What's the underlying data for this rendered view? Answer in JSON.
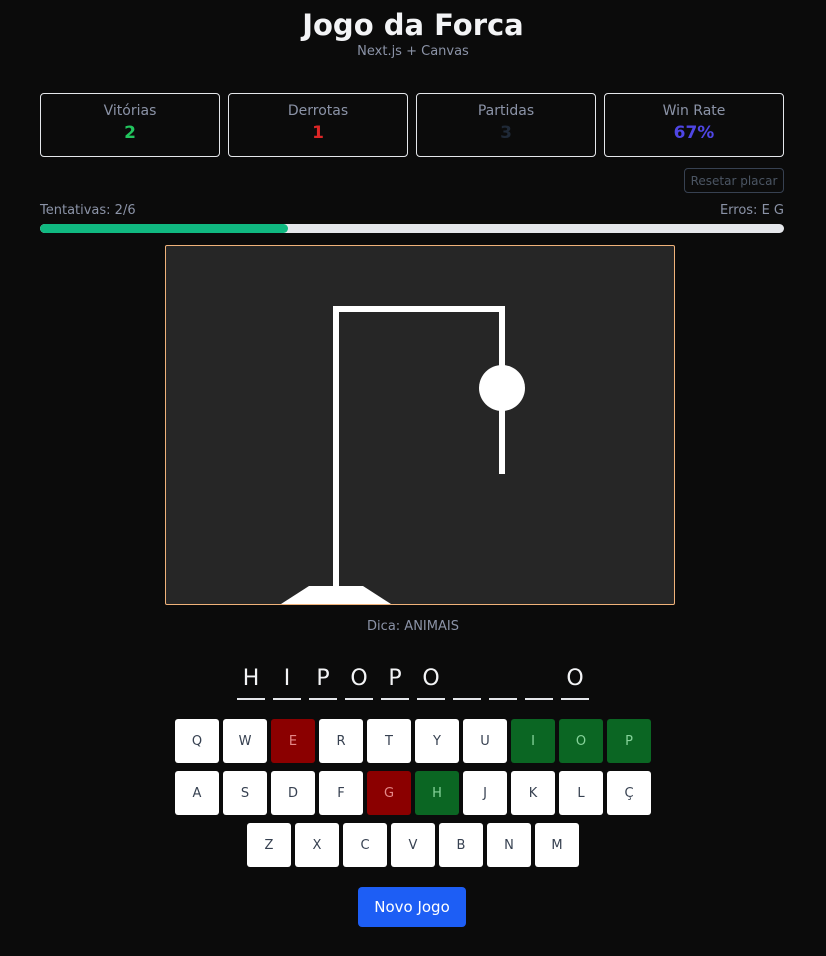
{
  "header": {
    "title": "Jogo da Forca",
    "subtitle": "Next.js + Canvas"
  },
  "stats": [
    {
      "label": "Vitórias",
      "value": "2",
      "color": "#22c55e"
    },
    {
      "label": "Derrotas",
      "value": "1",
      "color": "#dc2626"
    },
    {
      "label": "Partidas",
      "value": "3",
      "color": "#1f2937"
    },
    {
      "label": "Win Rate",
      "value": "67%",
      "color": "#4f46e5"
    }
  ],
  "reset_label": "Resetar placar",
  "progress": {
    "attempts_text": "Tentativas: 2/6",
    "errors_text": "Erros: E G",
    "fraction": 0.3333,
    "color": "#10b981"
  },
  "hint": "Dica: ANIMAIS",
  "word_slots": [
    "H",
    "I",
    "P",
    "O",
    "P",
    "O",
    "",
    "",
    "",
    "O"
  ],
  "keyboard": {
    "rows": [
      [
        "Q",
        "W",
        "E",
        "R",
        "T",
        "Y",
        "U",
        "I",
        "O",
        "P"
      ],
      [
        "A",
        "S",
        "D",
        "F",
        "G",
        "H",
        "J",
        "K",
        "L",
        "Ç"
      ],
      [
        "Z",
        "X",
        "C",
        "V",
        "B",
        "N",
        "M"
      ]
    ],
    "wrong": [
      "E",
      "G"
    ],
    "correct": [
      "I",
      "O",
      "P",
      "H"
    ]
  },
  "new_game_label": "Novo Jogo",
  "gallows": {
    "parts_drawn": [
      "head",
      "body"
    ],
    "errors": 2
  }
}
